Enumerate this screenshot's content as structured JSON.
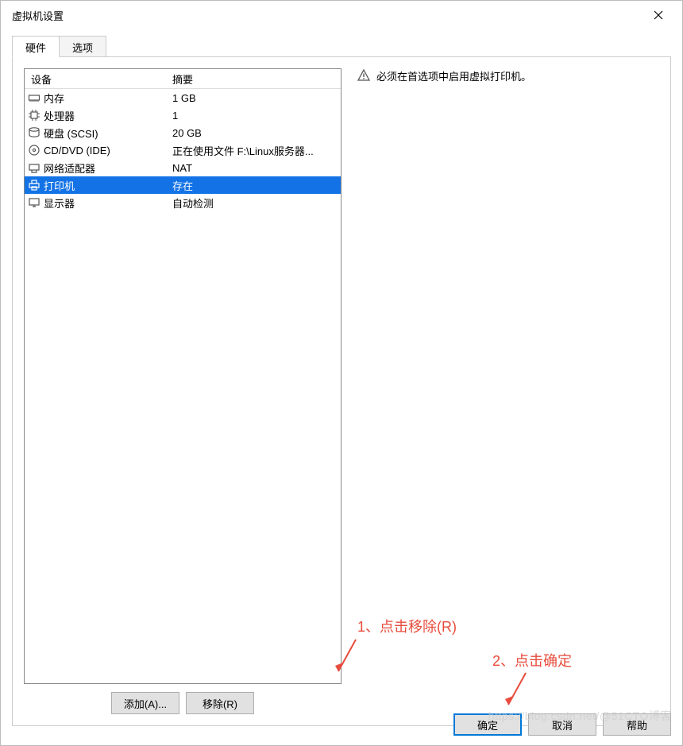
{
  "title": "虚拟机设置",
  "tabs": {
    "hardware": "硬件",
    "options": "选项"
  },
  "list_header": {
    "device": "设备",
    "summary": "摘要"
  },
  "devices": [
    {
      "icon": "memory-icon",
      "label": "内存",
      "summary": "1 GB"
    },
    {
      "icon": "cpu-icon",
      "label": "处理器",
      "summary": "1"
    },
    {
      "icon": "disk-icon",
      "label": "硬盘 (SCSI)",
      "summary": "20 GB"
    },
    {
      "icon": "cd-icon",
      "label": "CD/DVD (IDE)",
      "summary": "正在使用文件 F:\\Linux服务器..."
    },
    {
      "icon": "nic-icon",
      "label": "网络适配器",
      "summary": "NAT"
    },
    {
      "icon": "printer-icon",
      "label": "打印机",
      "summary": "存在",
      "selected": true
    },
    {
      "icon": "display-icon",
      "label": "显示器",
      "summary": "自动检测"
    }
  ],
  "selected_index": 5,
  "buttons": {
    "add": "添加(A)...",
    "remove": "移除(R)",
    "ok": "确定",
    "cancel": "取消",
    "help": "帮助"
  },
  "info_message": "必须在首选项中启用虚拟打印机。",
  "annotations": {
    "step1": "1、点击移除(R)",
    "step2": "2、点击确定"
  },
  "watermark": "https://blog.csdn.net/@51CTO博客"
}
